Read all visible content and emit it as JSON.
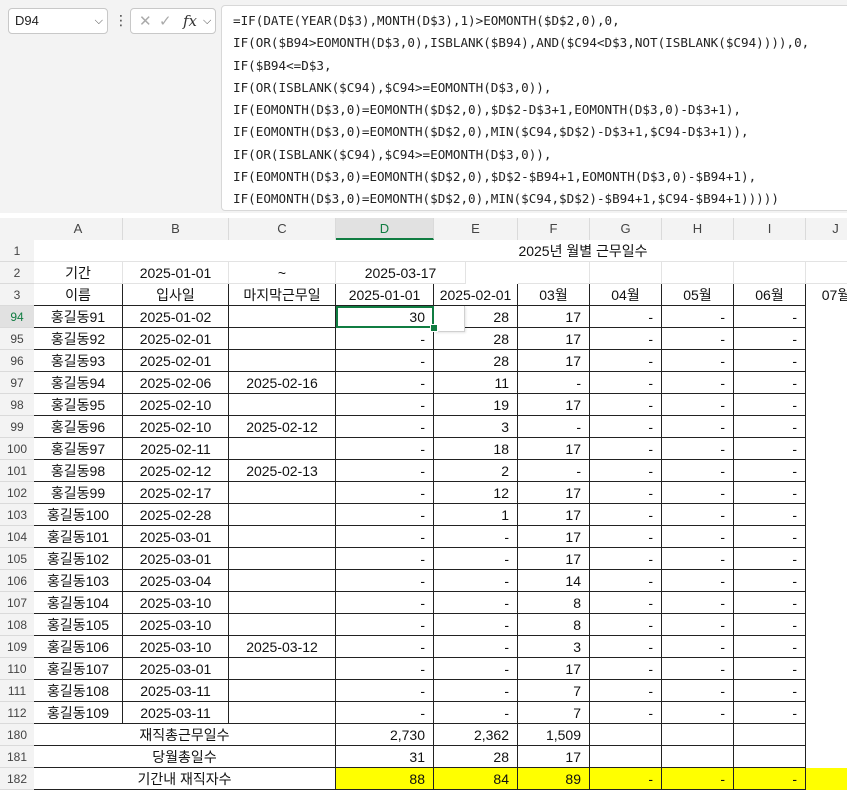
{
  "name_box": "D94",
  "formula_icons": {
    "cancel": "✕",
    "enter": "✓",
    "fx": "fx"
  },
  "formula_lines": [
    "=IF(DATE(YEAR(D$3),MONTH(D$3),1)>EOMONTH($D$2,0),0,",
    "IF(OR($B94>EOMONTH(D$3,0),ISBLANK($B94),AND($C94<D$3,NOT(ISBLANK($C94)))),0,",
    "IF($B94<=D$3,",
    "IF(OR(ISBLANK($C94),$C94>=EOMONTH(D$3,0)),",
    "IF(EOMONTH(D$3,0)=EOMONTH($D$2,0),$D$2-D$3+1,EOMONTH(D$3,0)-D$3+1),",
    "IF(EOMONTH(D$3,0)=EOMONTH($D$2,0),MIN($C94,$D$2)-D$3+1,$C94-D$3+1)),",
    "IF(OR(ISBLANK($C94),$C94>=EOMONTH(D$3,0)),",
    "IF(EOMONTH(D$3,0)=EOMONTH($D$2,0),$D$2-$B94+1,EOMONTH(D$3,0)-$B94+1),",
    "IF(EOMONTH(D$3,0)=EOMONTH($D$2,0),MIN($C94,$D$2)-$B94+1,$C94-$B94+1)))))"
  ],
  "columns": [
    "A",
    "B",
    "C",
    "D",
    "E",
    "F",
    "G",
    "H",
    "I",
    "J"
  ],
  "title": "2025년 월별 근무일수",
  "period": {
    "label": "기간",
    "start": "2025-01-01",
    "sep": "~",
    "end": "2025-03-17"
  },
  "headers": [
    "이름",
    "입사일",
    "마지막근무일",
    "2025-01-01",
    "2025-02-01",
    "03월",
    "04월",
    "05월",
    "06월",
    "07월"
  ],
  "rows": [
    {
      "num": "94",
      "name": "홍길동91",
      "hire": "2025-01-02",
      "last": "",
      "d": "30",
      "e": "28",
      "f": "17"
    },
    {
      "num": "95",
      "name": "홍길동92",
      "hire": "2025-02-01",
      "last": "",
      "d": "-",
      "e": "28",
      "f": "17"
    },
    {
      "num": "96",
      "name": "홍길동93",
      "hire": "2025-02-01",
      "last": "",
      "d": "-",
      "e": "28",
      "f": "17"
    },
    {
      "num": "97",
      "name": "홍길동94",
      "hire": "2025-02-06",
      "last": "2025-02-16",
      "d": "-",
      "e": "11",
      "f": "-"
    },
    {
      "num": "98",
      "name": "홍길동95",
      "hire": "2025-02-10",
      "last": "",
      "d": "-",
      "e": "19",
      "f": "17"
    },
    {
      "num": "99",
      "name": "홍길동96",
      "hire": "2025-02-10",
      "last": "2025-02-12",
      "d": "-",
      "e": "3",
      "f": "-"
    },
    {
      "num": "100",
      "name": "홍길동97",
      "hire": "2025-02-11",
      "last": "",
      "d": "-",
      "e": "18",
      "f": "17"
    },
    {
      "num": "101",
      "name": "홍길동98",
      "hire": "2025-02-12",
      "last": "2025-02-13",
      "d": "-",
      "e": "2",
      "f": "-"
    },
    {
      "num": "102",
      "name": "홍길동99",
      "hire": "2025-02-17",
      "last": "",
      "d": "-",
      "e": "12",
      "f": "17"
    },
    {
      "num": "103",
      "name": "홍길동100",
      "hire": "2025-02-28",
      "last": "",
      "d": "-",
      "e": "1",
      "f": "17"
    },
    {
      "num": "104",
      "name": "홍길동101",
      "hire": "2025-03-01",
      "last": "",
      "d": "-",
      "e": "-",
      "f": "17"
    },
    {
      "num": "105",
      "name": "홍길동102",
      "hire": "2025-03-01",
      "last": "",
      "d": "-",
      "e": "-",
      "f": "17"
    },
    {
      "num": "106",
      "name": "홍길동103",
      "hire": "2025-03-04",
      "last": "",
      "d": "-",
      "e": "-",
      "f": "14"
    },
    {
      "num": "107",
      "name": "홍길동104",
      "hire": "2025-03-10",
      "last": "",
      "d": "-",
      "e": "-",
      "f": "8"
    },
    {
      "num": "108",
      "name": "홍길동105",
      "hire": "2025-03-10",
      "last": "",
      "d": "-",
      "e": "-",
      "f": "8"
    },
    {
      "num": "109",
      "name": "홍길동106",
      "hire": "2025-03-10",
      "last": "2025-03-12",
      "d": "-",
      "e": "-",
      "f": "3"
    },
    {
      "num": "110",
      "name": "홍길동107",
      "hire": "2025-03-01",
      "last": "",
      "d": "-",
      "e": "-",
      "f": "17"
    },
    {
      "num": "111",
      "name": "홍길동108",
      "hire": "2025-03-11",
      "last": "",
      "d": "-",
      "e": "-",
      "f": "7"
    },
    {
      "num": "112",
      "name": "홍길동109",
      "hire": "2025-03-11",
      "last": "",
      "d": "-",
      "e": "-",
      "f": "7"
    }
  ],
  "empty_month_value": "-",
  "summary": [
    {
      "num": "180",
      "label": "재직총근무일수",
      "d": "2,730",
      "e": "2,362",
      "f": "1,509",
      "highlight": false
    },
    {
      "num": "181",
      "label": "당월총일수",
      "d": "31",
      "e": "28",
      "f": "17",
      "highlight": false
    },
    {
      "num": "182",
      "label": "기간내 재직자수",
      "d": "88",
      "e": "84",
      "f": "89",
      "highlight": true
    }
  ],
  "colors": {
    "selection": "#107c41",
    "highlight": "#ffff00"
  }
}
